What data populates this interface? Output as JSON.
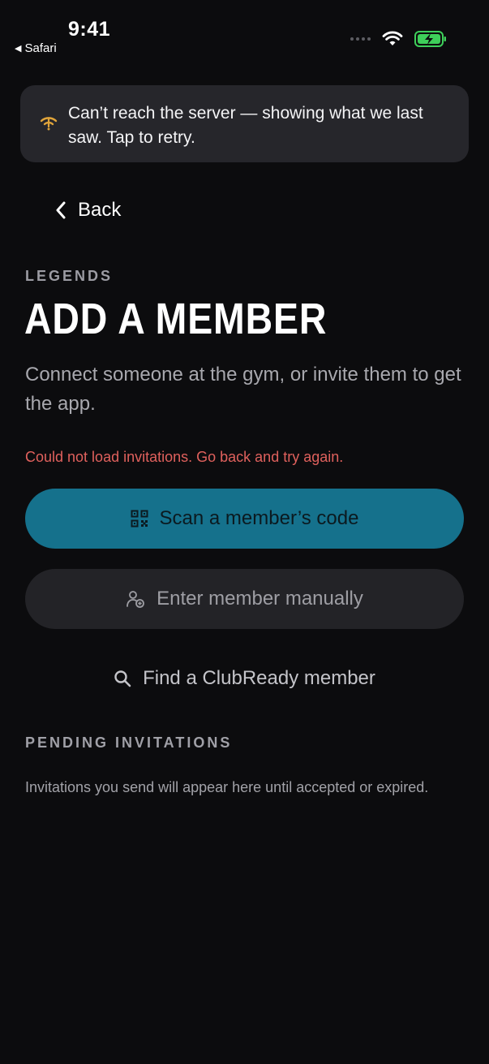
{
  "status_bar": {
    "time": "9:41",
    "back_app": "Safari"
  },
  "banner": {
    "message": "Can’t reach the server — showing what we last saw. Tap to retry.",
    "icon": "wifi-off-icon",
    "icon_color": "#e0a43a"
  },
  "nav": {
    "back_label": "Back"
  },
  "header": {
    "overline": "LEGENDS",
    "title": "ADD A MEMBER",
    "subtitle": "Connect someone at the gym, or invite them to get the app."
  },
  "error": {
    "message": "Could not load invitations. Go back and try again.",
    "color": "#e0615d"
  },
  "actions": {
    "scan_label": "Scan a member’s code",
    "scan_icon": "qr-code-icon",
    "manual_label": "Enter member manually",
    "manual_icon": "add-person-icon",
    "find_label": "Find a ClubReady member",
    "find_icon": "search-icon",
    "primary_color": "#15718c"
  },
  "pending": {
    "label": "PENDING INVITATIONS",
    "empty_text": "Invitations you send will appear here until accepted or expired."
  }
}
